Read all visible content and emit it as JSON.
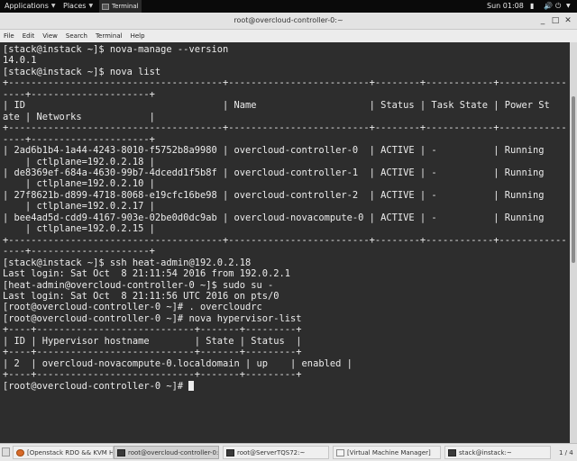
{
  "top_panel": {
    "applications": "Applications",
    "places": "Places",
    "terminal_app": "Terminal",
    "clock": "Sun 01:08"
  },
  "window": {
    "title": "root@overcloud-controller-0:~",
    "menu": [
      "File",
      "Edit",
      "View",
      "Search",
      "Terminal",
      "Help"
    ]
  },
  "terminal": {
    "lines": [
      "[stack@instack ~]$ nova-manage --version",
      "14.0.1",
      "[stack@instack ~]$ nova list",
      "+--------------------------------------+-------------------------+--------+------------+------------",
      "----+---------------------+",
      "| ID                                   | Name                    | Status | Task State | Power St",
      "ate | Networks            |",
      "+--------------------------------------+-------------------------+--------+------------+------------",
      "----+---------------------+",
      "| 2ad6b1b4-1a44-4243-8010-f5752b8a9980 | overcloud-controller-0  | ACTIVE | -          | Running",
      "    | ctlplane=192.0.2.18 |",
      "| de8369ef-684a-4630-99b7-4dcedd1f5b8f | overcloud-controller-1  | ACTIVE | -          | Running",
      "    | ctlplane=192.0.2.10 |",
      "| 27f8621b-d899-4718-8068-e19cfc16be98 | overcloud-controller-2  | ACTIVE | -          | Running",
      "    | ctlplane=192.0.2.17 |",
      "| bee4ad5d-cdd9-4167-903e-02be0d0dc9ab | overcloud-novacompute-0 | ACTIVE | -          | Running",
      "    | ctlplane=192.0.2.15 |",
      "+--------------------------------------+-------------------------+--------+------------+------------",
      "----+---------------------+",
      "[stack@instack ~]$ ssh heat-admin@192.0.2.18",
      "Last login: Sat Oct  8 21:11:54 2016 from 192.0.2.1",
      "[heat-admin@overcloud-controller-0 ~]$ sudo su -",
      "Last login: Sat Oct  8 21:11:56 UTC 2016 on pts/0",
      "[root@overcloud-controller-0 ~]# . overcloudrc",
      "[root@overcloud-controller-0 ~]# nova hypervisor-list",
      "+----+----------------------------+-------+---------+",
      "| ID | Hypervisor hostname        | State | Status  |",
      "+----+----------------------------+-------+---------+",
      "| 2  | overcloud-novacompute-0.localdomain | up    | enabled |",
      "+----+----------------------------+-------+---------+"
    ],
    "prompt": "[root@overcloud-controller-0 ~]# "
  },
  "taskbar": {
    "tasks": [
      "[Openstack RDO && KVM Hyp...",
      "root@overcloud-controller-0:~",
      "root@ServerTQS72:~",
      "[Virtual Machine Manager]",
      "stack@instack:~"
    ],
    "pager": "1 / 4"
  }
}
